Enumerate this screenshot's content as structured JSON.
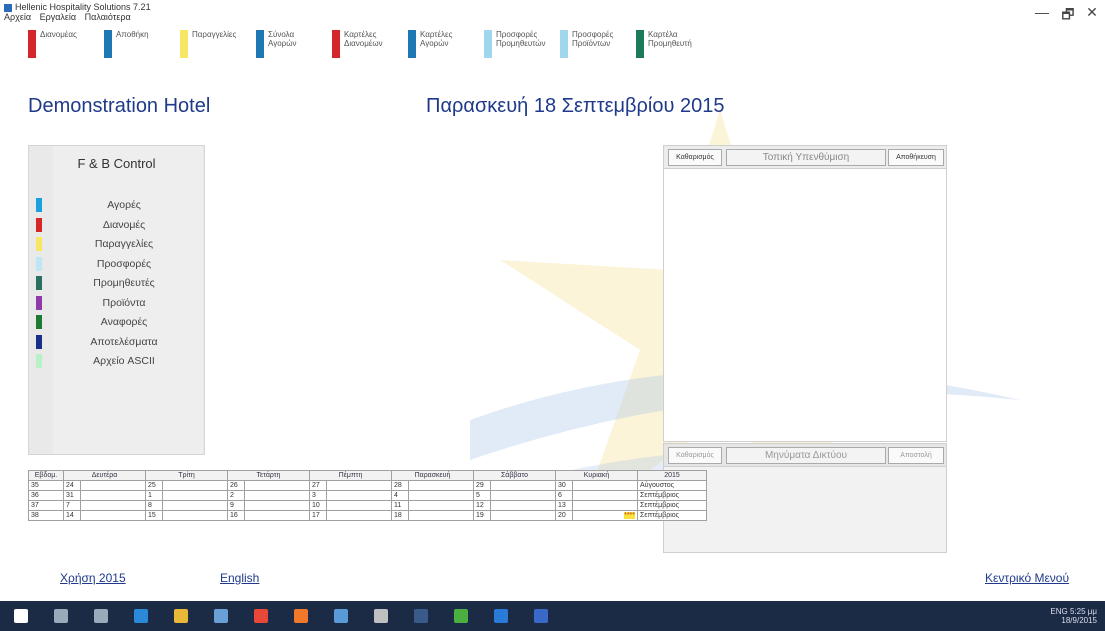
{
  "window": {
    "title": "Hellenic Hospitality Solutions 7.21",
    "controls": [
      "—",
      "🗗",
      "✕"
    ]
  },
  "menu": [
    "Αρχεία",
    "Εργαλεία",
    "Παλαιότερα"
  ],
  "toolbar": [
    {
      "label": "Διανομέας",
      "color": "#d62728"
    },
    {
      "label": "Αποθήκη",
      "color": "#1f77b4"
    },
    {
      "label": "Παραγγελίες",
      "color": "#f5e663"
    },
    {
      "label": "Σύνολα Αγορών",
      "color": "#1f77b4"
    },
    {
      "label": "Καρτέλες Διανομέων",
      "color": "#d62728"
    },
    {
      "label": "Καρτέλες Αγορών",
      "color": "#1f77b4"
    },
    {
      "label": "Προσφορές Προμηθευτών",
      "color": "#9fd8ec"
    },
    {
      "label": "Προσφορές Προϊόντων",
      "color": "#9fd8ec"
    },
    {
      "label": "Καρτέλα Προμηθευτή",
      "color": "#1a7a5a"
    }
  ],
  "header": {
    "hotel": "Demonstration Hotel",
    "date": "Παρασκευή 18 Σεπτεμβρίου 2015"
  },
  "fb_panel": {
    "title": "F & B Control",
    "items": [
      {
        "label": "Αγορές",
        "color": "#1aa0e0"
      },
      {
        "label": "Διανομές",
        "color": "#d62728"
      },
      {
        "label": "Παραγγελίες",
        "color": "#f5e663"
      },
      {
        "label": "Προσφορές",
        "color": "#bde8f2"
      },
      {
        "label": "Προμηθευτές",
        "color": "#2a7060"
      },
      {
        "label": "Προϊόντα",
        "color": "#8e3aa8"
      },
      {
        "label": "Αναφορές",
        "color": "#1e7a32"
      },
      {
        "label": "Αποτελέσματα",
        "color": "#1a2f8a"
      },
      {
        "label": "Αρχείο ASCII",
        "color": "#b8f0c8"
      }
    ]
  },
  "right_panel": {
    "top_tabs": [
      "Καθαρισμός",
      "Τοπική Υπενθύμιση",
      "Αποθήκευση"
    ],
    "bottom_tabs": [
      "Καθαρισμός",
      "Μηνύματα Δικτύου",
      "Αποστολή"
    ]
  },
  "calendar": {
    "headers": [
      "Εβδομ.",
      "Δευτέρα",
      "Τρίτη",
      "Τετάρτη",
      "Πέμπτη",
      "Παρασκευή",
      "Σάββατο",
      "Κυριακή",
      "2015"
    ],
    "rows": [
      {
        "week": "35",
        "days": [
          "24",
          "25",
          "26",
          "27",
          "28",
          "29",
          "30"
        ],
        "month": "Αύγουστος"
      },
      {
        "week": "36",
        "days": [
          "31",
          "1",
          "2",
          "3",
          "4",
          "5",
          "6"
        ],
        "month": "Σεπτέμβριος"
      },
      {
        "week": "37",
        "days": [
          "7",
          "8",
          "9",
          "10",
          "11",
          "12",
          "13"
        ],
        "month": "Σεπτέμβριος"
      },
      {
        "week": "38",
        "days": [
          "14",
          "15",
          "16",
          "17",
          "18",
          "19",
          "20"
        ],
        "month": "Σεπτέμβριος"
      }
    ],
    "today_marker": "****"
  },
  "footer": {
    "year_link": "Χρήση 2015",
    "lang_link": "English",
    "main_menu": "Κεντρικό Μενού"
  },
  "taskbar": {
    "icons": [
      "windows-icon",
      "search-icon",
      "task-view-icon",
      "edge-icon",
      "files-icon",
      "store-icon",
      "chrome-icon",
      "firefox-icon",
      "phone-icon",
      "app-icon",
      "terminal-icon",
      "star-icon",
      "app2-icon",
      "word-icon"
    ],
    "time": "5:25 μμ",
    "date": "18/9/2015",
    "lang": "ENG"
  }
}
